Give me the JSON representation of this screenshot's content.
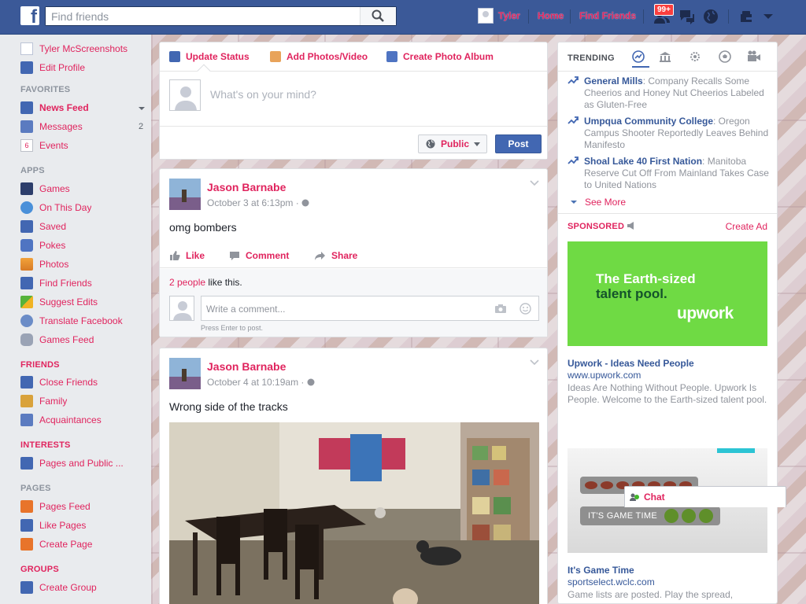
{
  "topbar": {
    "logo": "f",
    "search_placeholder": "Find friends",
    "user_name": "Tyler",
    "home_label": "Home",
    "find_friends_label": "Find Friends",
    "notification_badge": "99+"
  },
  "sidebar": {
    "profile_name": "Tyler McScreenshots",
    "edit_profile": "Edit Profile",
    "sections": {
      "favorites": "FAVORITES",
      "apps": "APPS",
      "friends": "FRIENDS",
      "interests": "INTERESTS",
      "pages": "PAGES",
      "groups": "GROUPS"
    },
    "favorites": [
      {
        "label": "News Feed"
      },
      {
        "label": "Messages",
        "count": "2"
      },
      {
        "label": "Events"
      }
    ],
    "apps": [
      {
        "label": "Games"
      },
      {
        "label": "On This Day"
      },
      {
        "label": "Saved"
      },
      {
        "label": "Pokes"
      },
      {
        "label": "Photos"
      },
      {
        "label": "Find Friends"
      },
      {
        "label": "Suggest Edits"
      },
      {
        "label": "Translate Facebook"
      },
      {
        "label": "Games Feed"
      }
    ],
    "friends": [
      {
        "label": "Close Friends"
      },
      {
        "label": "Family"
      },
      {
        "label": "Acquaintances"
      }
    ],
    "interests": [
      {
        "label": "Pages and Public ..."
      }
    ],
    "pages": [
      {
        "label": "Pages Feed"
      },
      {
        "label": "Like Pages"
      },
      {
        "label": "Create Page"
      }
    ],
    "groups": [
      {
        "label": "Create Group"
      }
    ],
    "events_day": "6"
  },
  "composer": {
    "tab_status": "Update Status",
    "tab_photos": "Add Photos/Video",
    "tab_album": "Create Photo Album",
    "placeholder": "What's on your mind?",
    "privacy": "Public",
    "post_button": "Post"
  },
  "posts": [
    {
      "author": "Jason Barnabe",
      "time": "October 3 at 6:13pm",
      "text": "omg bombers",
      "like": "Like",
      "comment": "Comment",
      "share": "Share",
      "likes_count": "2 people",
      "likes_suffix": " like this.",
      "comment_placeholder": "Write a comment...",
      "comment_hint": "Press Enter to post."
    },
    {
      "author": "Jason Barnabe",
      "time": "October 4 at 10:19am",
      "text": "Wrong side of the tracks"
    }
  ],
  "right": {
    "trending_label": "TRENDING",
    "trending": [
      {
        "topic": "General Mills",
        "desc": ": Company Recalls Some Cheerios and Honey Nut Cheerios Labeled as Gluten-Free"
      },
      {
        "topic": "Umpqua Community College",
        "desc": ": Oregon Campus Shooter Reportedly Leaves Behind Manifesto"
      },
      {
        "topic": "Shoal Lake 40 First Nation",
        "desc": ": Manitoba Reserve Cut Off From Mainland Takes Case to United Nations"
      }
    ],
    "see_more": "See More",
    "sponsored": "SPONSORED",
    "create_ad": "Create Ad",
    "ad1": {
      "line1": "The Earth-sized",
      "line2": "talent pool.",
      "logo": "upwork",
      "title": "Upwork - Ideas Need People",
      "url": "www.upwork.com",
      "desc": "Ideas Are Nothing Without People. Upwork Is People. Welcome to the Earth-sized talent pool."
    },
    "ad2": {
      "banner": "IT'S GAME TIME",
      "title": "It's Game Time",
      "url": "sportselect.wclc.com",
      "desc": "Game lists are posted. Play the spread,"
    }
  },
  "chat": {
    "label": "Chat"
  }
}
